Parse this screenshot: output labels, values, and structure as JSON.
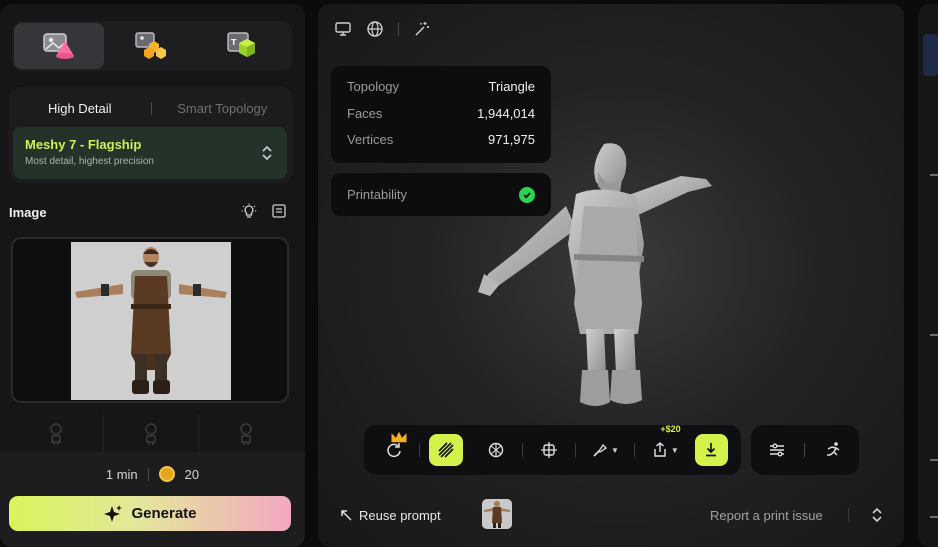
{
  "left_panel": {
    "mode_tabs": [
      {
        "name": "image-to-3d",
        "active": true
      },
      {
        "name": "multi-image-to-3d",
        "active": false
      },
      {
        "name": "texture-to-3d",
        "active": false
      }
    ],
    "detail_tabs": {
      "high_detail": "High Detail",
      "smart_topology": "Smart Topology"
    },
    "model_select": {
      "name": "Meshy 7 - Flagship",
      "subtitle": "Most detail, highest precision"
    },
    "image_section": {
      "label": "Image"
    },
    "cost": {
      "time": "1 min",
      "credits": "20"
    },
    "generate_label": "Generate"
  },
  "viewport": {
    "stats": {
      "topology_label": "Topology",
      "topology_value": "Triangle",
      "faces_label": "Faces",
      "faces_value": "1,944,014",
      "vertices_label": "Vertices",
      "vertices_value": "971,975"
    },
    "printability_label": "Printability",
    "toolbar": {
      "price_badge": "+$20"
    },
    "bottom": {
      "reuse_label": "Reuse prompt",
      "report_label": "Report a print issue"
    }
  },
  "colors": {
    "accent_lime": "#d4f34a",
    "model_name": "#c9f25c",
    "check_green": "#2fd24f"
  }
}
